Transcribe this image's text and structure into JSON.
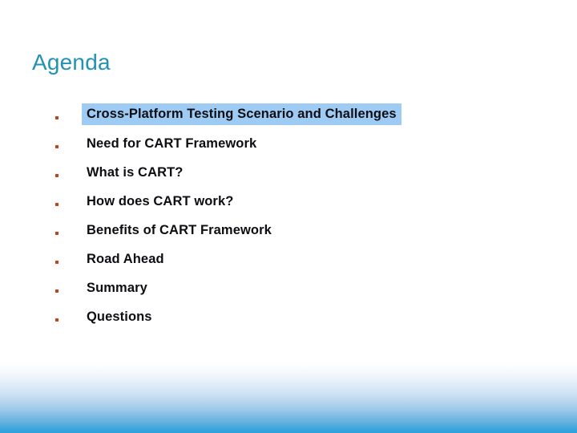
{
  "slide": {
    "title": "Agenda",
    "title_color": "#2292b4",
    "background_color": "#ffffff",
    "bullet_marker_color": "#c0441b",
    "highlight_color": "#9ecbf4",
    "text_color": "#0d0d12",
    "bottom_band_color": "#2da0da",
    "items": [
      {
        "label": "Cross-Platform Testing Scenario and Challenges",
        "highlighted": true
      },
      {
        "label": "Need for CART Framework",
        "highlighted": false
      },
      {
        "label": "What is CART?",
        "highlighted": false
      },
      {
        "label": "How does CART work?",
        "highlighted": false
      },
      {
        "label": "Benefits of CART Framework",
        "highlighted": false
      },
      {
        "label": "Road Ahead",
        "highlighted": false
      },
      {
        "label": "Summary",
        "highlighted": false
      },
      {
        "label": "Questions",
        "highlighted": false
      }
    ]
  }
}
